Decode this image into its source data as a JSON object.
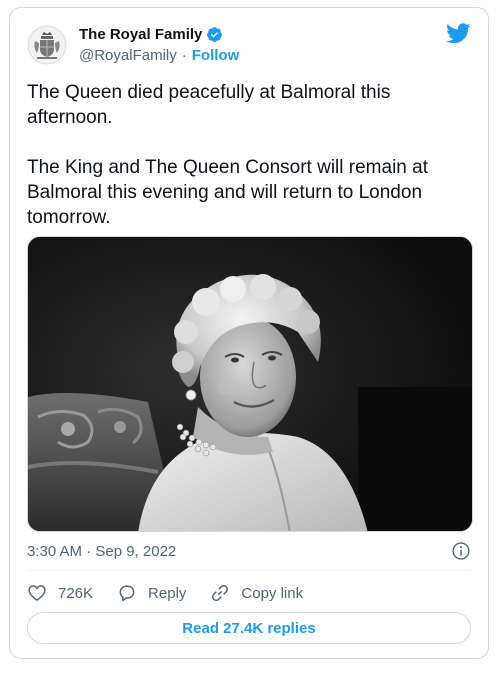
{
  "account": {
    "display_name": "The Royal Family",
    "handle": "@RoyalFamily",
    "separator": "·",
    "follow_label": "Follow"
  },
  "tweet": {
    "paragraphs": [
      "The Queen died peacefully at Balmoral this afternoon.",
      "The King and The Queen Consort will remain at Balmoral this evening and will return to London tomorrow."
    ],
    "timestamp": "3:30 AM · Sep 9, 2022"
  },
  "actions": {
    "likes_count": "726K",
    "reply_label": "Reply",
    "copy_link_label": "Copy link"
  },
  "read_replies_label": "Read 27.4K replies",
  "icons": {
    "avatar": "royal-coat-of-arms-icon",
    "verified": "verified-badge-icon",
    "brand": "twitter-bird-icon",
    "info": "info-icon",
    "like": "heart-icon",
    "reply": "speech-bubble-icon",
    "copy": "link-icon"
  },
  "colors": {
    "accent": "#1d9bf0",
    "text": "#0f1419",
    "secondary_text": "#536471",
    "border": "#cfd9de"
  }
}
